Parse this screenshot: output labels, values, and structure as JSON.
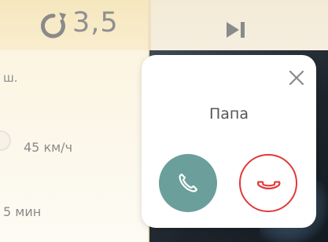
{
  "navigation": {
    "turn_value": "3,5",
    "fragment_text": "ш.",
    "speed": "45 км/ч",
    "time": "5 мин"
  },
  "call": {
    "caller_name": "Папа"
  },
  "colors": {
    "accept": "#6a9f9b",
    "decline": "#e03a3a",
    "text_muted": "#8f8f8f"
  },
  "icons": {
    "turn": "u-turn-arrow-icon",
    "next": "next-track-icon",
    "close": "close-icon",
    "accept": "phone-accept-icon",
    "decline": "phone-decline-icon"
  }
}
